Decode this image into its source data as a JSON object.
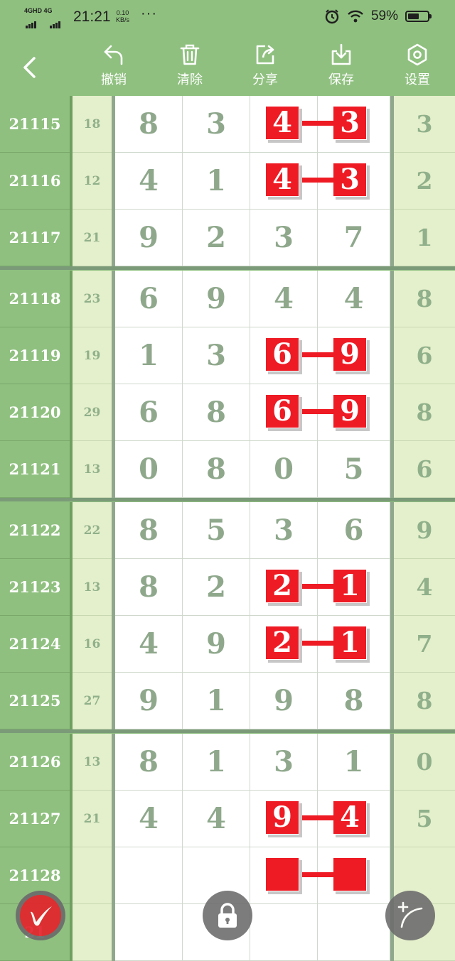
{
  "status_bar": {
    "network": "4GHD 4G",
    "time": "21:21",
    "speed_value": "0.10",
    "speed_unit": "KB/s",
    "dots": "···",
    "battery": "59%",
    "battery_level": 0.59
  },
  "toolbar": {
    "undo_label": "撤销",
    "clear_label": "清除",
    "share_label": "分享",
    "save_label": "保存",
    "settings_label": "设置"
  },
  "rows": [
    {
      "issue": "21115",
      "sum": "18",
      "digits": [
        "8",
        "3",
        "4",
        "3"
      ],
      "last": "3",
      "hl": true
    },
    {
      "issue": "21116",
      "sum": "12",
      "digits": [
        "4",
        "1",
        "4",
        "3"
      ],
      "last": "2",
      "hl": true
    },
    {
      "issue": "21117",
      "sum": "21",
      "digits": [
        "9",
        "2",
        "3",
        "7"
      ],
      "last": "1",
      "hl": false
    },
    {
      "issue": "21118",
      "sum": "23",
      "digits": [
        "6",
        "9",
        "4",
        "4"
      ],
      "last": "8",
      "hl": false
    },
    {
      "issue": "21119",
      "sum": "19",
      "digits": [
        "1",
        "3",
        "6",
        "9"
      ],
      "last": "6",
      "hl": true
    },
    {
      "issue": "21120",
      "sum": "29",
      "digits": [
        "6",
        "8",
        "6",
        "9"
      ],
      "last": "8",
      "hl": true
    },
    {
      "issue": "21121",
      "sum": "13",
      "digits": [
        "0",
        "8",
        "0",
        "5"
      ],
      "last": "6",
      "hl": false
    },
    {
      "issue": "21122",
      "sum": "22",
      "digits": [
        "8",
        "5",
        "3",
        "6"
      ],
      "last": "9",
      "hl": false
    },
    {
      "issue": "21123",
      "sum": "13",
      "digits": [
        "8",
        "2",
        "2",
        "1"
      ],
      "last": "4",
      "hl": true
    },
    {
      "issue": "21124",
      "sum": "16",
      "digits": [
        "4",
        "9",
        "2",
        "1"
      ],
      "last": "7",
      "hl": true
    },
    {
      "issue": "21125",
      "sum": "27",
      "digits": [
        "9",
        "1",
        "9",
        "8"
      ],
      "last": "8",
      "hl": false
    },
    {
      "issue": "21126",
      "sum": "13",
      "digits": [
        "8",
        "1",
        "3",
        "1"
      ],
      "last": "0",
      "hl": false
    },
    {
      "issue": "21127",
      "sum": "21",
      "digits": [
        "4",
        "4",
        "9",
        "4"
      ],
      "last": "5",
      "hl": true
    },
    {
      "issue": "21128",
      "sum": "",
      "digits": [
        "",
        "",
        "",
        ""
      ],
      "last": "",
      "hl": true
    },
    {
      "issue": "21",
      "sum": "",
      "digits": [
        "",
        "",
        "",
        ""
      ],
      "last": "",
      "hl": false
    }
  ],
  "colors": {
    "accent_green": "#8fc07f",
    "highlight_red": "#ee1b24",
    "digit_gray": "#8fa88c"
  },
  "icons": {
    "back": "chevron-left-icon",
    "undo": "undo-arrow-icon",
    "clear": "trash-icon",
    "share": "share-icon",
    "save": "download-icon",
    "settings": "hexagon-gear-icon",
    "pen": "pen-brush-icon",
    "lock": "lock-icon",
    "draw": "draw-line-icon"
  }
}
